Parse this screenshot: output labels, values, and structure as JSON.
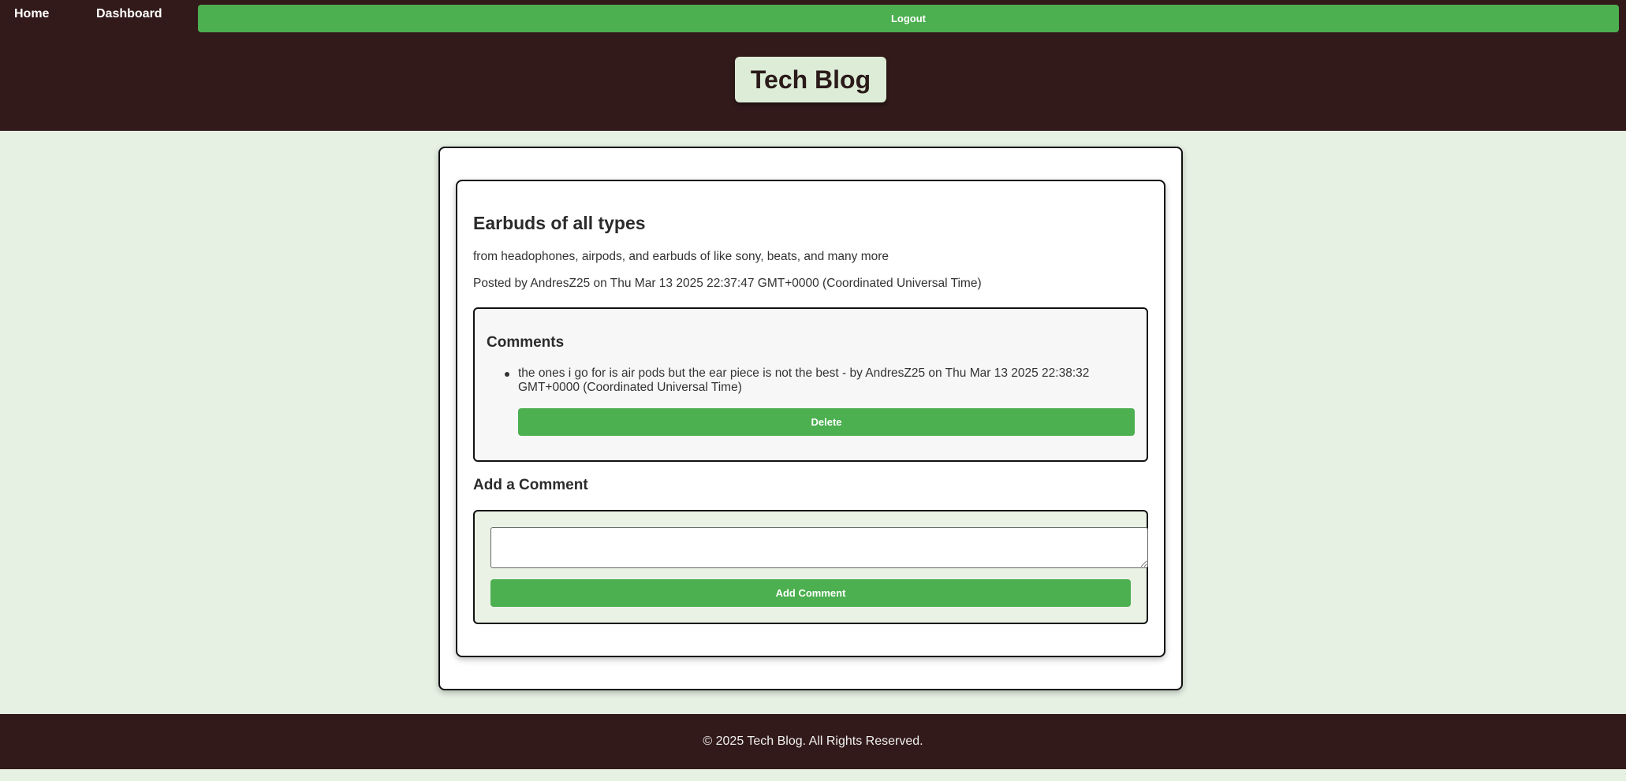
{
  "nav": {
    "home_label": "Home",
    "dashboard_label": "Dashboard",
    "logout_label": "Logout"
  },
  "site": {
    "title": "Tech Blog"
  },
  "post": {
    "title": "Earbuds of all types",
    "content": "from headophones, airpods, and earbuds of like sony, beats, and many more",
    "meta": "Posted by AndresZ25 on Thu Mar 13 2025 22:37:47 GMT+0000 (Coordinated Universal Time)"
  },
  "comments": {
    "heading": "Comments",
    "items": [
      {
        "text": "the ones i go for is air pods but the ear piece is not the best - by AndresZ25 on Thu Mar 13 2025 22:38:32 GMT+0000 (Coordinated Universal Time)",
        "delete_label": "Delete"
      }
    ]
  },
  "add_comment": {
    "heading": "Add a Comment",
    "textarea_value": "",
    "button_label": "Add Comment"
  },
  "footer": {
    "text": "© 2025 Tech Blog. All Rights Reserved."
  },
  "colors": {
    "header_bg": "#331a1a",
    "page_bg": "#e6f0e3",
    "accent_green": "#4caf50",
    "title_badge_bg": "#dcecd6"
  }
}
